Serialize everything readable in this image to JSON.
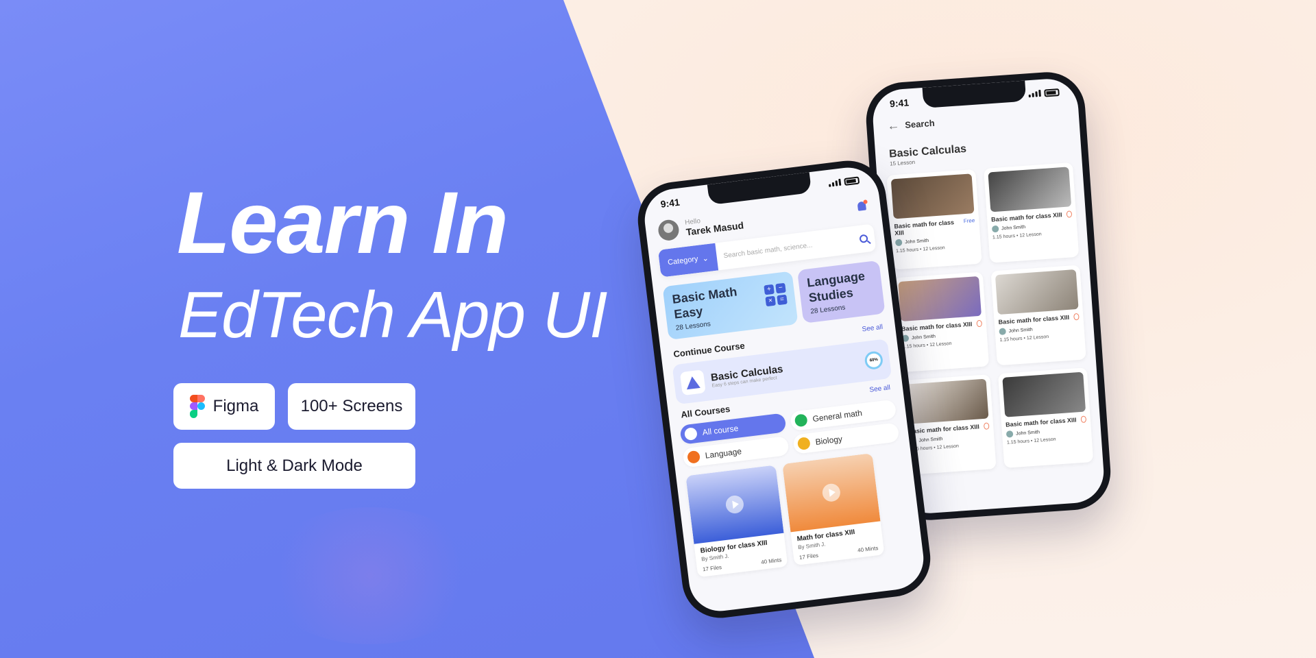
{
  "hero": {
    "title": "Learn In",
    "subtitle": "EdTech App UI",
    "badges": [
      "Figma",
      "100+ Screens",
      "Light & Dark Mode"
    ]
  },
  "phone1": {
    "time": "9:41",
    "greeting": "Hello",
    "user_name": "Tarek Masud",
    "category_label": "Category",
    "search_placeholder": "Search basic math, science...",
    "featured": [
      {
        "title": "Basic Math Easy",
        "lessons": "28 Lessons"
      },
      {
        "title": "Language Studies",
        "lessons": "28 Lessons"
      }
    ],
    "continue_heading": "Continue Course",
    "see_all": "See all",
    "continue_course": {
      "title": "Basic Calculas",
      "subtitle": "Easy 6 steps can make perfect",
      "progress": "60%"
    },
    "all_courses_heading": "All Courses",
    "chips": [
      {
        "label": "All course",
        "active": true
      },
      {
        "label": "General math",
        "active": false
      },
      {
        "label": "Language",
        "active": false
      },
      {
        "label": "Biology",
        "active": false
      }
    ],
    "courses": [
      {
        "title": "Biology for class XIII",
        "author": "By Smith J.",
        "files": "17 Files",
        "duration": "40 Mints"
      },
      {
        "title": "Math for class XIII",
        "author": "By Smith J.",
        "files": "17 Files",
        "duration": "40 Mints"
      }
    ]
  },
  "phone2": {
    "time": "9:41",
    "back_label": "Search",
    "title": "Basic Calculas",
    "subtitle": "15 Lesson",
    "cards": [
      {
        "title": "Basic math for class XIII",
        "tag": "Free",
        "author": "John Smith",
        "hours": "1.15 hours",
        "lessons": "12 Lesson"
      },
      {
        "title": "Basic math for class XIII",
        "tag": "",
        "author": "John Smith",
        "hours": "1.15 hours",
        "lessons": "12 Lesson"
      },
      {
        "title": "Basic math for class XIII",
        "tag": "",
        "author": "John Smith",
        "hours": "1.15 hours",
        "lessons": "12 Lesson"
      },
      {
        "title": "Basic math for class XIII",
        "tag": "",
        "author": "John Smith",
        "hours": "1.15 hours",
        "lessons": "12 Lesson"
      },
      {
        "title": "Basic math for class XIII",
        "tag": "",
        "author": "John Smith",
        "hours": "1.15 hours",
        "lessons": "12 Lesson"
      },
      {
        "title": "Basic math for class XIII",
        "tag": "",
        "author": "John Smith",
        "hours": "1.15 hours",
        "lessons": "12 Lesson"
      }
    ]
  },
  "colors": {
    "brand": "#6476ec",
    "accent": "#ff6a4a",
    "warm_bg": "#fbeee3"
  }
}
